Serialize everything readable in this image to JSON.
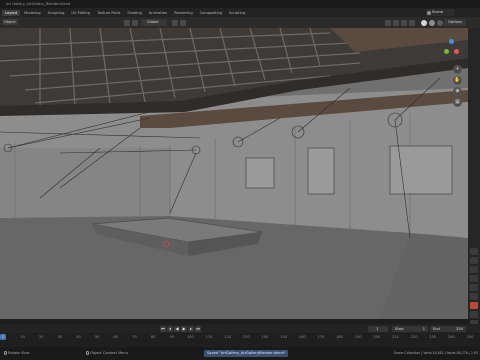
{
  "file_path": "Art Gallery_ArtGallery_Blender.blend",
  "workspace_tabs": [
    "Layout",
    "Modeling",
    "Sculpting",
    "UV Editing",
    "Texture Paint",
    "Shading",
    "Animation",
    "Rendering",
    "Compositing",
    "Scripting"
  ],
  "active_tab_index": 0,
  "scene_name": "Scene",
  "viewport_header": {
    "mode_label": "Object",
    "orientation": "Global",
    "options_label": "Options"
  },
  "gizmo": {
    "x_color": "#e05561",
    "y_color": "#7cb342",
    "z_color": "#4a90d9"
  },
  "timeline": {
    "current_frame": "1",
    "start_label": "Start",
    "start_value": "1",
    "end_label": "End",
    "end_value": "250",
    "ruler_ticks": [
      "0",
      "10",
      "20",
      "30",
      "40",
      "50",
      "60",
      "70",
      "80",
      "90",
      "100",
      "110",
      "120",
      "130",
      "140",
      "150",
      "160",
      "170",
      "180",
      "190",
      "200",
      "210",
      "220",
      "230",
      "240",
      "250"
    ]
  },
  "status_bar": {
    "left_text": "Rotate View",
    "middle_text": "Object Context Menu",
    "saved_message": "Saved \"ArtGallery_ArtGalleryBlender.blend\"",
    "right_text": "Scene Collection | Verts:19,482 | Faces:38,276 | 2.93"
  },
  "accent_color": "#4772b3"
}
